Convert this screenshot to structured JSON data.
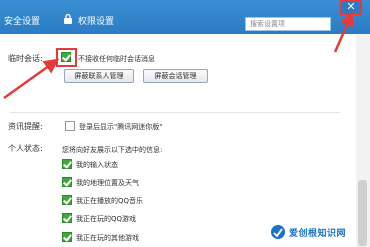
{
  "header": {
    "security_settings": "安全设置",
    "permission_settings": "权限设置",
    "search_placeholder": "搜索设置项",
    "close_symbol": "✕"
  },
  "temp_session": {
    "label": "临时会话:",
    "checkbox_label": "不接收任何临时会话消息",
    "checked": true,
    "buttons": [
      "屏蔽联系人管理",
      "屏蔽会话管理"
    ]
  },
  "news_reminder": {
    "label": "资讯提醒:",
    "checkbox_label": "登录后显示\"腾讯网迷你版\"",
    "checked": false
  },
  "personal_status": {
    "label": "个人状态:",
    "intro": "您将向好友展示以下选中的信息:",
    "items": [
      {
        "label": "我的输入状态",
        "checked": true
      },
      {
        "label": "我的地理位置及天气",
        "checked": true
      },
      {
        "label": "我正在播放的QQ音乐",
        "checked": true
      },
      {
        "label": "我正在玩的QQ游戏",
        "checked": true
      },
      {
        "label": "我正在玩的其他游戏",
        "checked": true
      }
    ]
  },
  "watermark": {
    "text": "爱创根知识网"
  },
  "colors": {
    "titlebar": "#2c7bc4",
    "highlight": "#e53a3a",
    "checkbox_checked": "#3eaa3a"
  }
}
